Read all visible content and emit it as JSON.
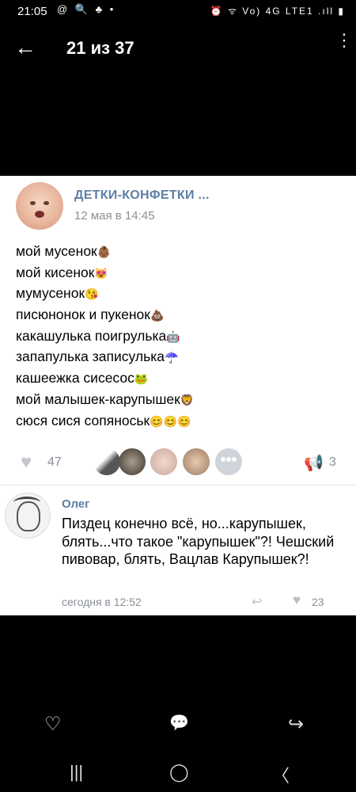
{
  "status_bar": {
    "time": "21:05",
    "left_icons": "@ 🔍 ♣ •",
    "right_icons": "⏰ ᯤ Vo) 4G LTE1 .ıll ▮"
  },
  "app_bar": {
    "back_icon": "←",
    "title": "21 из 37",
    "menu_icon": "⋮"
  },
  "post": {
    "group_name": "ДЕТКИ-КОНФЕТКИ ...",
    "date": "12 мая в 14:45",
    "lines": [
      {
        "text": "мой мусенок",
        "emoji": "👶🏾"
      },
      {
        "text": "мой кисенок",
        "emoji": "😻"
      },
      {
        "text": "мумусенок",
        "emoji": "😘"
      },
      {
        "text": "писюнонок и пукенок",
        "emoji": "💩"
      },
      {
        "text": "какашулька поигрулька",
        "emoji": "🤖"
      },
      {
        "text": "запапулька записулька",
        "emoji": "☂️"
      },
      {
        "text": "кашеежка сисесос",
        "emoji": "🐸"
      },
      {
        "text": "мой малышек-карупышек",
        "emoji": "🦁"
      },
      {
        "text": "сюся сися сопяноськ",
        "emoji": "😊😊😊"
      }
    ],
    "likes": "47",
    "shares": "3",
    "more_label": "•••",
    "like_icon": "♥",
    "share_icon": "📢"
  },
  "comment": {
    "author": "Олег",
    "text": "Пиздец конечно всё, но...карупышек, блять...что такое \"карупышек\"?! Чешский пивовар, блять, Вацлав Карупышек?!",
    "date": "сегодня в 12:52",
    "likes": "23",
    "reply_icon": "↩",
    "like_icon": "♥"
  },
  "bottom_actions": {
    "like_icon": "♡",
    "comment_icon": "💬",
    "share_icon": "↪"
  },
  "nav_bar": {
    "recents_icon": "|||",
    "home_icon": "◯",
    "back_icon": "〈"
  },
  "colors": {
    "accent": "#5d7fa3",
    "secondary_text": "#8a8f96",
    "background": "#000000",
    "card": "#ffffff"
  }
}
